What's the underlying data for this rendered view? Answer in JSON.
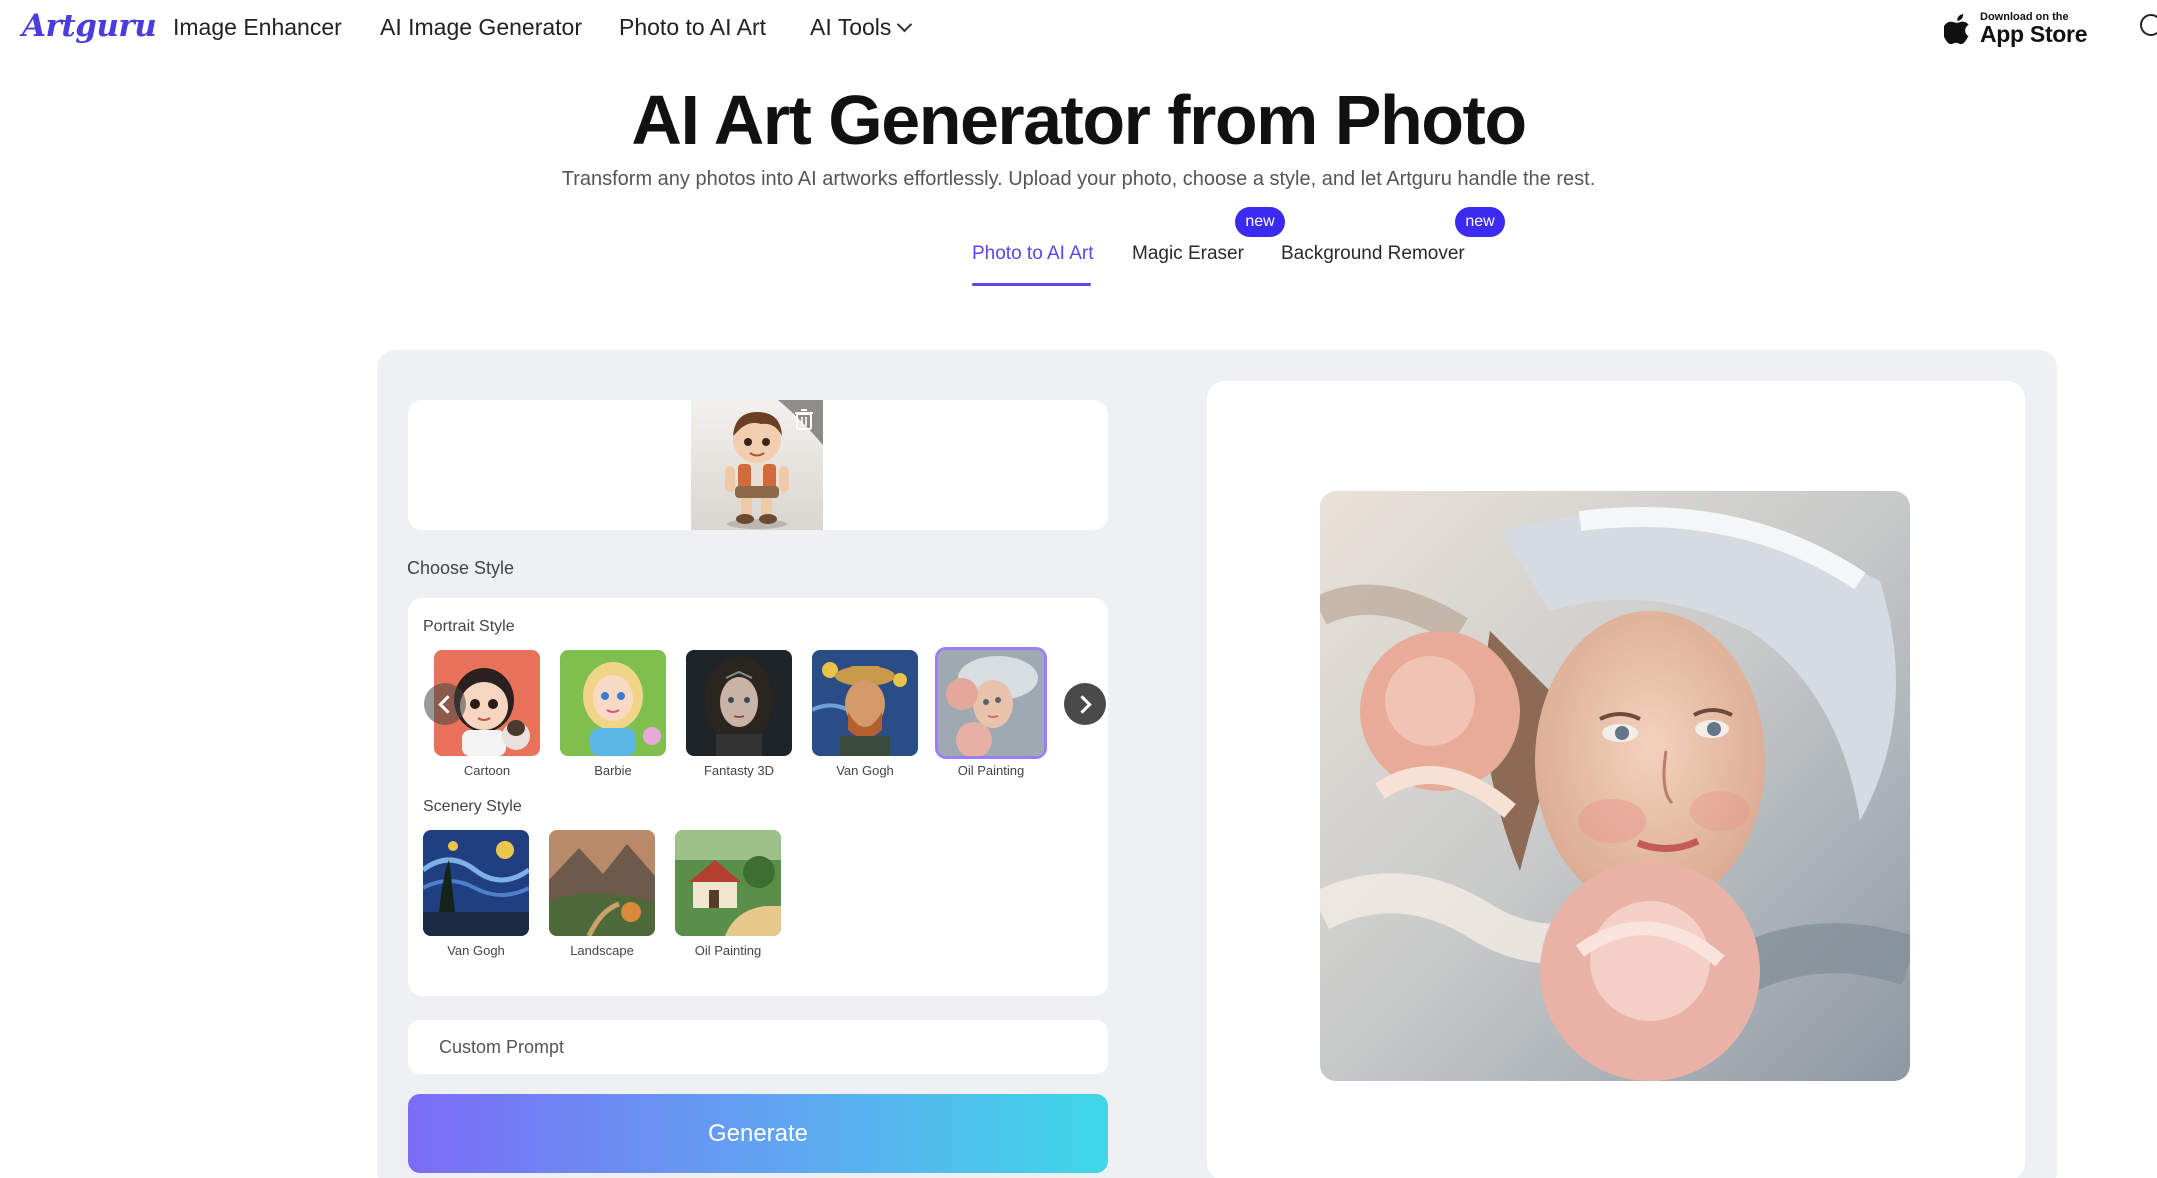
{
  "nav": {
    "logo": "Artguru",
    "links": [
      "Image Enhancer",
      "AI Image Generator",
      "Photo to AI Art",
      "AI Tools"
    ],
    "app_store_small": "Download on the",
    "app_store_big": "App Store"
  },
  "hero": {
    "title": "AI Art Generator from Photo",
    "subtitle": "Transform any photos into AI artworks effortlessly. Upload your photo, choose a style, and let Artguru handle the rest."
  },
  "tabs": [
    {
      "label": "Photo to AI Art",
      "active": true
    },
    {
      "label": "Magic Eraser",
      "badge": "new"
    },
    {
      "label": "Background Remover",
      "badge": "new"
    }
  ],
  "editor": {
    "choose_style_label": "Choose Style",
    "portrait_label": "Portrait Style",
    "portrait_styles": [
      "Cartoon",
      "Barbie",
      "Fantasty 3D",
      "Van Gogh",
      "Oil Painting"
    ],
    "selected_style": "Oil Painting",
    "scenery_label": "Scenery Style",
    "scenery_styles": [
      "Van Gogh",
      "Landscape",
      "Oil Painting"
    ],
    "prompt_placeholder": "Custom Prompt",
    "generate_label": "Generate"
  },
  "colors": {
    "accent": "#5b44f2",
    "badge": "#3b2bf0",
    "panel_bg": "#eef0f3",
    "generate_gradient": [
      "#7b6cf6",
      "#3fd8e8"
    ]
  },
  "icons": [
    "chevron-down-icon",
    "apple-icon",
    "globe-icon",
    "trash-icon",
    "chevron-left-icon",
    "chevron-right-icon"
  ]
}
